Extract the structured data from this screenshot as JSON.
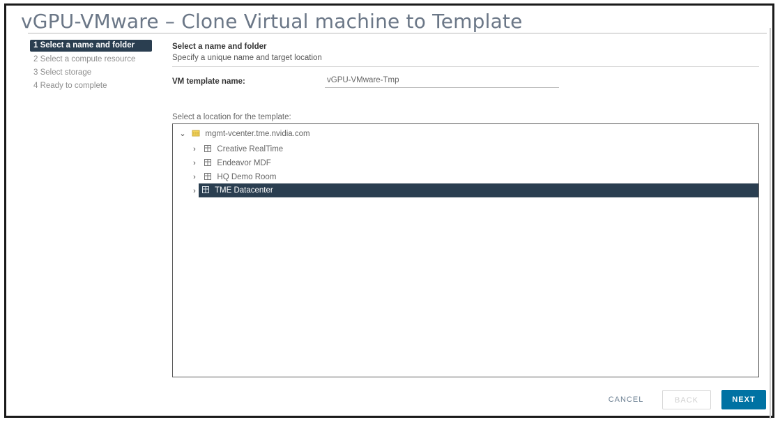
{
  "window": {
    "title": "vGPU-VMware – Clone Virtual machine to Template"
  },
  "steps": [
    {
      "label": "1 Select a name and folder",
      "active": true
    },
    {
      "label": "2 Select a compute resource",
      "active": false
    },
    {
      "label": "3 Select storage",
      "active": false
    },
    {
      "label": "4 Ready to complete",
      "active": false
    }
  ],
  "main": {
    "heading": "Select a name and folder",
    "subheading": "Specify a unique name and target location",
    "name_label": "VM template name:",
    "name_value": "vGPU-VMware-Tmp",
    "location_label": "Select a location for the template:"
  },
  "tree": {
    "root": {
      "label": "mgmt-vcenter.tme.nvidia.com",
      "icon": "vcenter-icon"
    },
    "items": [
      {
        "label": "Creative RealTime",
        "icon": "datacenter-icon"
      },
      {
        "label": "Endeavor MDF",
        "icon": "datacenter-icon"
      },
      {
        "label": "HQ Demo Room",
        "icon": "datacenter-icon"
      },
      {
        "label": "TME Datacenter",
        "icon": "datacenter-icon",
        "selected": true
      }
    ]
  },
  "footer": {
    "cancel_label": "CANCEL",
    "back_label": "BACK",
    "next_label": "NEXT"
  },
  "colors": {
    "accent": "#0072a3",
    "selection": "#2a3e50",
    "title": "#6b7787"
  }
}
